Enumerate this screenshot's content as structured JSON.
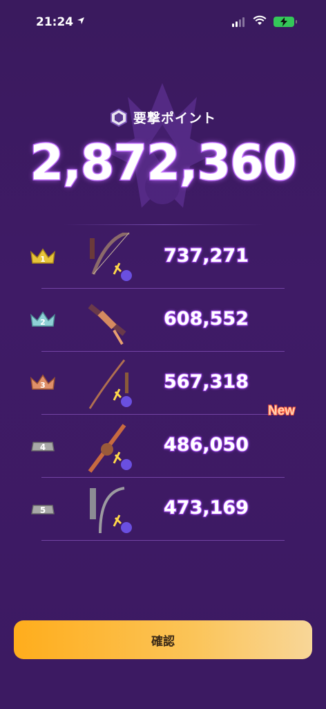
{
  "status_bar": {
    "time": "21:24"
  },
  "header": {
    "title": "要撃ポイント",
    "total": "2,872,360"
  },
  "ranking": [
    {
      "rank": "1",
      "score": "737,271",
      "badge": "",
      "medal_color": "#e8c43a"
    },
    {
      "rank": "2",
      "score": "608,552",
      "badge": "",
      "medal_color": "#8fd0d6"
    },
    {
      "rank": "3",
      "score": "567,318",
      "badge": "",
      "medal_color": "#e0906a"
    },
    {
      "rank": "4",
      "score": "486,050",
      "badge": "New",
      "medal_color": "#a8a8a8"
    },
    {
      "rank": "5",
      "score": "473,169",
      "badge": "",
      "medal_color": "#a8a8a8"
    }
  ],
  "footer": {
    "confirm_label": "確認"
  },
  "colors": {
    "background": "#3f1b66",
    "accent": "#b14cff",
    "button": "#ffad1c"
  }
}
